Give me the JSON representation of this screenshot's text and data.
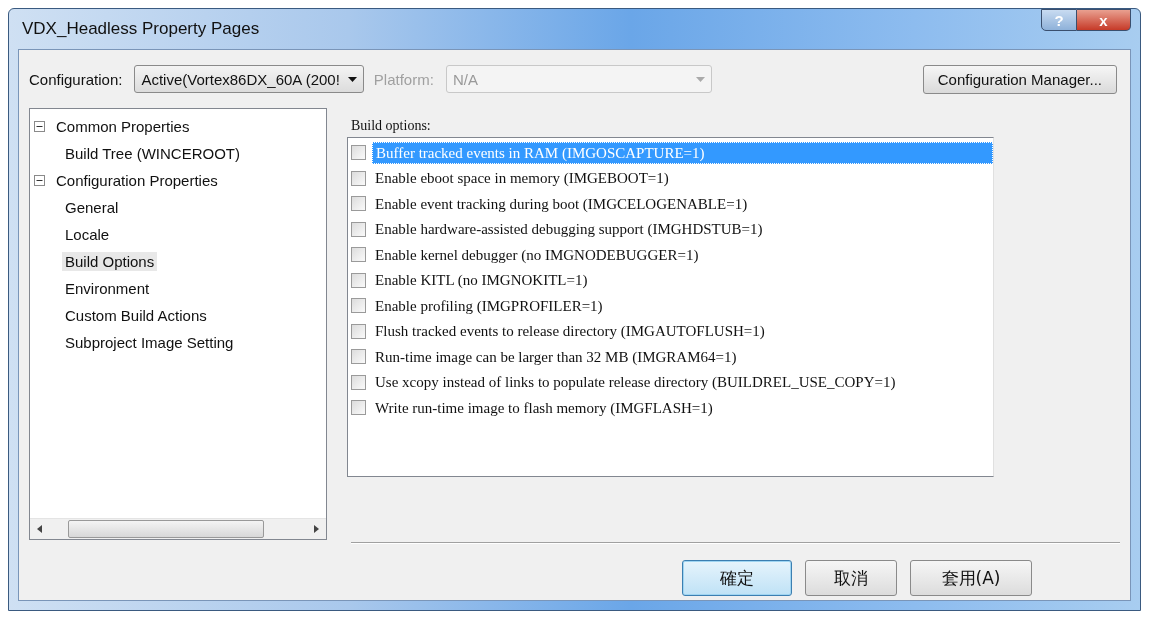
{
  "window": {
    "title": "VDX_Headless Property Pages",
    "buttons": [
      "?",
      "x"
    ]
  },
  "configuration": {
    "label": "Configuration:",
    "value": "Active(Vortex86DX_60A (200!"
  },
  "platform": {
    "label": "Platform:",
    "value": "N/A",
    "disabled": true
  },
  "config_manager_button": "Configuration Manager...",
  "tree": [
    {
      "label": "Common Properties",
      "expanded": true,
      "selected": false,
      "children": [
        {
          "label": "Build Tree (WINCEROOT)",
          "selected": false
        }
      ]
    },
    {
      "label": "Configuration Properties",
      "expanded": true,
      "selected": false,
      "children": [
        {
          "label": "General",
          "selected": false
        },
        {
          "label": "Locale",
          "selected": false
        },
        {
          "label": "Build Options",
          "selected": true
        },
        {
          "label": "Environment",
          "selected": false
        },
        {
          "label": "Custom Build Actions",
          "selected": false
        },
        {
          "label": "Subproject Image Setting",
          "selected": false
        }
      ]
    }
  ],
  "build_options": {
    "label": "Build options:",
    "items": [
      {
        "label": "Buffer tracked events in RAM (IMGOSCAPTURE=1)",
        "checked": false,
        "selected": true
      },
      {
        "label": "Enable eboot space in memory (IMGEBOOT=1)",
        "checked": false,
        "selected": false
      },
      {
        "label": "Enable event tracking during boot (IMGCELOGENABLE=1)",
        "checked": false,
        "selected": false
      },
      {
        "label": "Enable hardware-assisted debugging support (IMGHDSTUB=1)",
        "checked": false,
        "selected": false
      },
      {
        "label": "Enable kernel debugger (no IMGNODEBUGGER=1)",
        "checked": false,
        "selected": false
      },
      {
        "label": "Enable KITL (no IMGNOKITL=1)",
        "checked": false,
        "selected": false
      },
      {
        "label": "Enable profiling (IMGPROFILER=1)",
        "checked": false,
        "selected": false
      },
      {
        "label": "Flush tracked events to release directory (IMGAUTOFLUSH=1)",
        "checked": false,
        "selected": false
      },
      {
        "label": "Run-time image can be larger than 32 MB (IMGRAM64=1)",
        "checked": false,
        "selected": false
      },
      {
        "label": "Use xcopy instead of links to populate release directory (BUILDREL_USE_COPY=1)",
        "checked": false,
        "selected": false
      },
      {
        "label": "Write run-time image to flash memory (IMGFLASH=1)",
        "checked": false,
        "selected": false
      }
    ]
  },
  "buttons": [
    {
      "label": "確定",
      "default": true
    },
    {
      "label": "取消",
      "default": false
    },
    {
      "label": "套用(A)",
      "default": false
    }
  ]
}
